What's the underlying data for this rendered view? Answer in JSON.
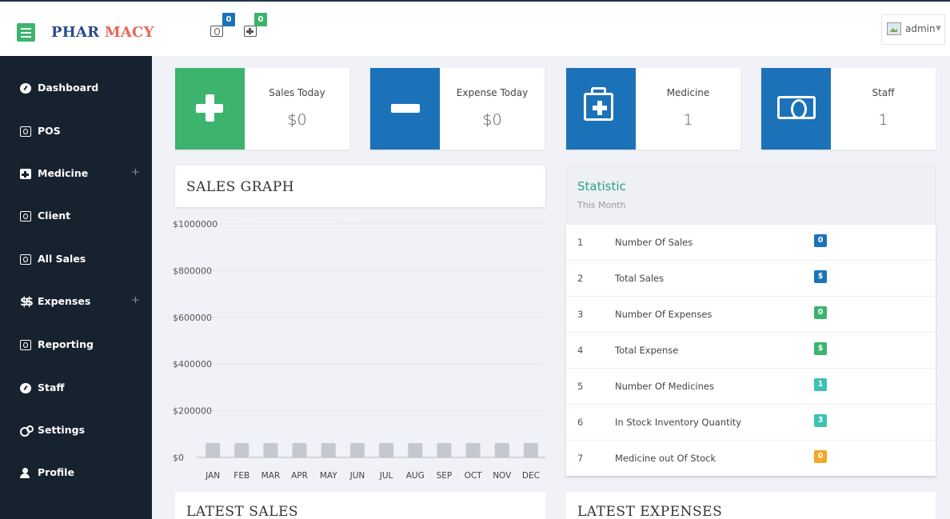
{
  "header": {
    "brand_part1": "PHAR",
    "brand_part2": "MACY",
    "sales_badge": "0",
    "medicine_badge": "0",
    "user_name": "admin"
  },
  "sidebar": {
    "items": [
      {
        "label": "Dashboard",
        "icon": "dashboard-icon"
      },
      {
        "label": "POS",
        "icon": "money-icon"
      },
      {
        "label": "Medicine",
        "icon": "medkit-icon",
        "expandable": "+"
      },
      {
        "label": "Client",
        "icon": "money-icon"
      },
      {
        "label": "All Sales",
        "icon": "money-icon"
      },
      {
        "label": "Expenses",
        "icon": "dollar-icon",
        "expandable": "+"
      },
      {
        "label": "Reporting",
        "icon": "money-icon"
      },
      {
        "label": "Staff",
        "icon": "dashboard-icon"
      },
      {
        "label": "Settings",
        "icon": "cogs-icon"
      },
      {
        "label": "Profile",
        "icon": "user-icon"
      }
    ]
  },
  "cards": [
    {
      "label": "Sales Today",
      "value": "$0",
      "color": "#3cb46e",
      "icon": "plus-icon"
    },
    {
      "label": "Expense Today",
      "value": "$0",
      "color": "#1c72b9",
      "icon": "minus-icon"
    },
    {
      "label": "Medicine",
      "value": "1",
      "color": "#1c72b9",
      "icon": "medkit-icon"
    },
    {
      "label": "Staff",
      "value": "1",
      "color": "#1c72b9",
      "icon": "money-icon"
    }
  ],
  "sales_graph": {
    "title": "SALES GRAPH"
  },
  "chart_data": {
    "type": "bar",
    "categories": [
      "JAN",
      "FEB",
      "MAR",
      "APR",
      "MAY",
      "JUN",
      "JUL",
      "AUG",
      "SEP",
      "OCT",
      "NOV",
      "DEC"
    ],
    "values": [
      0,
      0,
      0,
      0,
      0,
      0,
      0,
      0,
      0,
      0,
      0,
      0
    ],
    "y_ticks": [
      "$0",
      "$200000",
      "$400000",
      "$600000",
      "$800000",
      "$1000000"
    ],
    "ylim": [
      0,
      1000000
    ],
    "grid": true,
    "bar_color": "#c4c8d0"
  },
  "statistic": {
    "title": "Statistic",
    "subtitle": "This Month",
    "rows": [
      {
        "num": "1",
        "name": "Number Of Sales",
        "badge": "0",
        "color": "#1c72b9"
      },
      {
        "num": "2",
        "name": "Total Sales",
        "badge": "$",
        "color": "#1c72b9"
      },
      {
        "num": "3",
        "name": "Number Of Expenses",
        "badge": "0",
        "color": "#3cb46e"
      },
      {
        "num": "4",
        "name": "Total Expense",
        "badge": "$",
        "color": "#3cb46e"
      },
      {
        "num": "5",
        "name": "Number Of Medicines",
        "badge": "1",
        "color": "#3cc3b0"
      },
      {
        "num": "6",
        "name": "In Stock Inventory Quantity",
        "badge": "3",
        "color": "#3cc3b0"
      },
      {
        "num": "7",
        "name": "Medicine out Of Stock",
        "badge": "0",
        "color": "#f5a623"
      }
    ]
  },
  "latest_sales": {
    "title": "LATEST SALES"
  },
  "latest_expenses": {
    "title": "LATEST EXPENSES"
  }
}
